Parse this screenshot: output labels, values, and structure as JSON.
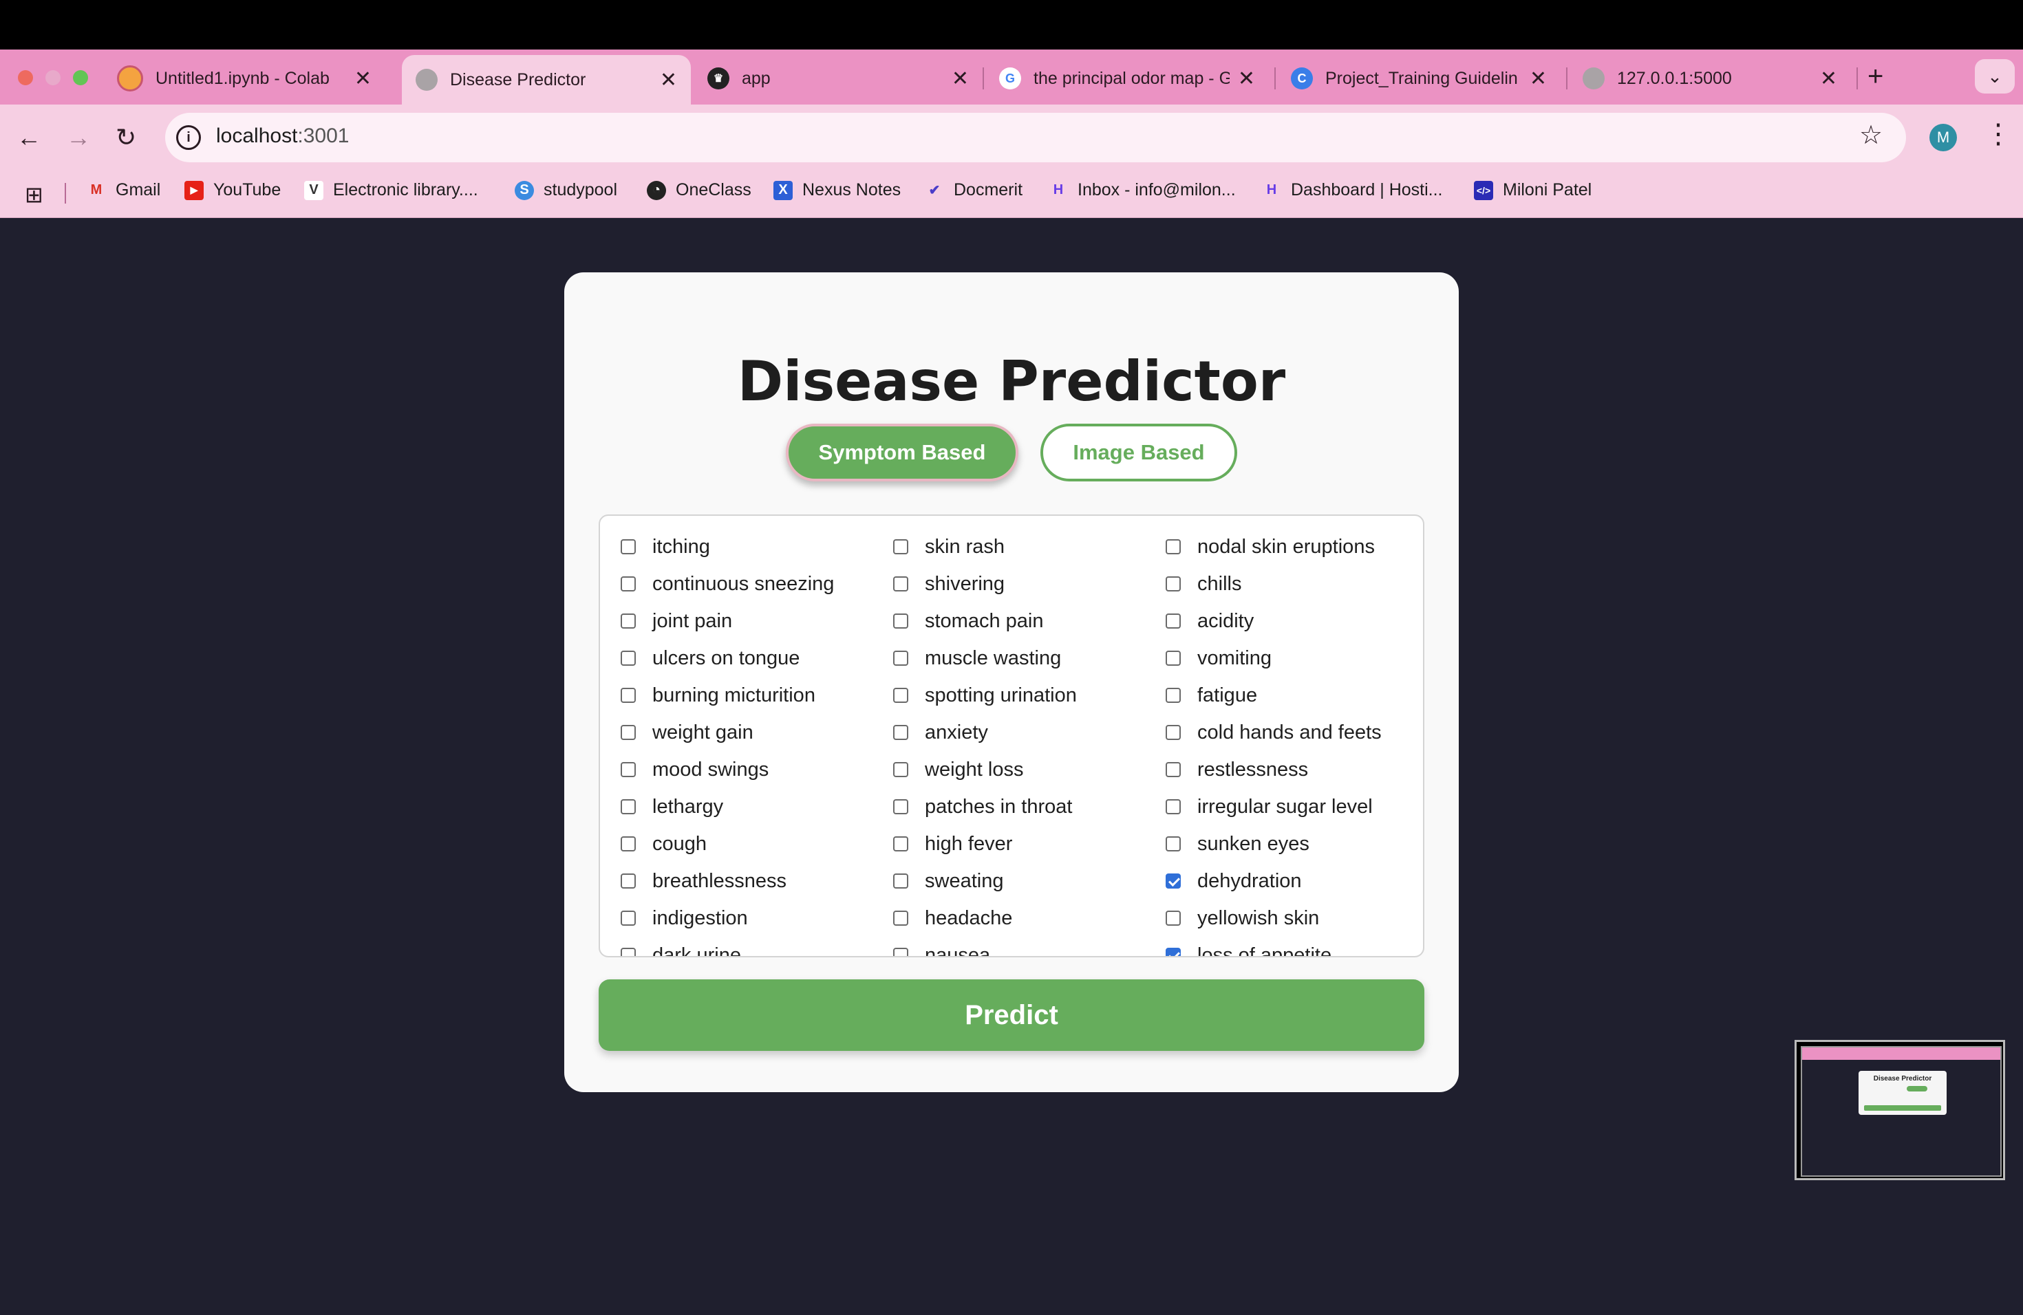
{
  "browser": {
    "tabs": [
      {
        "label": "Untitled1.ipynb - Colab",
        "icon": "colab-icon",
        "active": false
      },
      {
        "label": "Disease Predictor",
        "icon": "globe-icon",
        "active": true
      },
      {
        "label": "app",
        "icon": "streamlit-crown-icon",
        "active": false
      },
      {
        "label": "the principal odor map - G",
        "icon": "google-icon",
        "active": false
      },
      {
        "label": "Project_Training Guidelin",
        "icon": "canva-icon",
        "active": false
      },
      {
        "label": "127.0.0.1:5000",
        "icon": "globe-icon",
        "active": false
      }
    ],
    "url_host": "localhost",
    "url_port": ":3001",
    "profile_initial": "M",
    "bookmarks": [
      {
        "label": "Gmail",
        "icon": "gmail-icon"
      },
      {
        "label": "YouTube",
        "icon": "youtube-icon"
      },
      {
        "label": "Electronic library....",
        "icon": "v-icon"
      },
      {
        "label": "studypool",
        "icon": "studypool-icon"
      },
      {
        "label": "OneClass",
        "icon": "oneclass-icon"
      },
      {
        "label": "Nexus Notes",
        "icon": "nexus-icon"
      },
      {
        "label": "Docmerit",
        "icon": "docmerit-icon"
      },
      {
        "label": "Inbox - info@milon...",
        "icon": "hostinger-icon"
      },
      {
        "label": "Dashboard | Hosti...",
        "icon": "hostinger-icon"
      },
      {
        "label": "Miloni Patel",
        "icon": "code-icon"
      }
    ]
  },
  "app": {
    "title": "Disease Predictor",
    "mode_symptom": "Symptom Based",
    "mode_image": "Image Based",
    "predict_label": "Predict",
    "symptoms": [
      {
        "label": "itching",
        "checked": false
      },
      {
        "label": "skin rash",
        "checked": false
      },
      {
        "label": "nodal skin eruptions",
        "checked": false
      },
      {
        "label": "continuous sneezing",
        "checked": false
      },
      {
        "label": "shivering",
        "checked": false
      },
      {
        "label": "chills",
        "checked": false
      },
      {
        "label": "joint pain",
        "checked": false
      },
      {
        "label": "stomach pain",
        "checked": false
      },
      {
        "label": "acidity",
        "checked": false
      },
      {
        "label": "ulcers on tongue",
        "checked": false
      },
      {
        "label": "muscle wasting",
        "checked": false
      },
      {
        "label": "vomiting",
        "checked": false
      },
      {
        "label": "burning micturition",
        "checked": false
      },
      {
        "label": "spotting urination",
        "checked": false
      },
      {
        "label": "fatigue",
        "checked": false
      },
      {
        "label": "weight gain",
        "checked": false
      },
      {
        "label": "anxiety",
        "checked": false
      },
      {
        "label": "cold hands and feets",
        "checked": false
      },
      {
        "label": "mood swings",
        "checked": false
      },
      {
        "label": "weight loss",
        "checked": false
      },
      {
        "label": "restlessness",
        "checked": false
      },
      {
        "label": "lethargy",
        "checked": false
      },
      {
        "label": "patches in throat",
        "checked": false
      },
      {
        "label": "irregular sugar level",
        "checked": false
      },
      {
        "label": "cough",
        "checked": false
      },
      {
        "label": "high fever",
        "checked": false
      },
      {
        "label": "sunken eyes",
        "checked": false
      },
      {
        "label": "breathlessness",
        "checked": false
      },
      {
        "label": "sweating",
        "checked": false
      },
      {
        "label": "dehydration",
        "checked": true
      },
      {
        "label": "indigestion",
        "checked": false
      },
      {
        "label": "headache",
        "checked": false
      },
      {
        "label": "yellowish skin",
        "checked": false
      },
      {
        "label": "dark urine",
        "checked": false
      },
      {
        "label": "nausea",
        "checked": false
      },
      {
        "label": "loss of appetite",
        "checked": true
      }
    ]
  },
  "thumbnail": {
    "title": "Disease Predictor"
  },
  "colors": {
    "accent_green": "#66ad5c",
    "tab_pink": "#eb92c3",
    "page_bg": "#1f1f2e",
    "checkbox_blue": "#2f6fd8"
  }
}
